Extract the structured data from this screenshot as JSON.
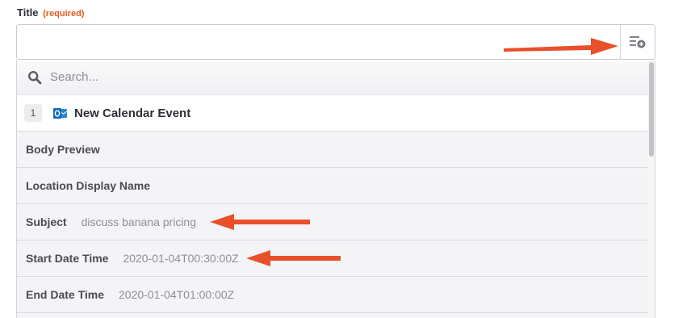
{
  "field": {
    "label": "Title",
    "required": "(required)",
    "value": ""
  },
  "insert_button": {
    "icon": "insert-data-icon"
  },
  "search": {
    "placeholder": "Search...",
    "icon": "search-icon"
  },
  "step": {
    "number": "1",
    "app_icon": "outlook-icon",
    "title": "New Calendar Event"
  },
  "options": [
    {
      "label": "Body Preview",
      "value": ""
    },
    {
      "label": "Location Display Name",
      "value": ""
    },
    {
      "label": "Subject",
      "value": "discuss banana pricing"
    },
    {
      "label": "Start Date Time",
      "value": "2020-01-04T00:30:00Z"
    },
    {
      "label": "End Date Time",
      "value": "2020-01-04T01:00:00Z"
    }
  ],
  "colors": {
    "accent": "#e5581f",
    "arrow": "#e8502a",
    "outlook_blue": "#0f6cbd"
  }
}
